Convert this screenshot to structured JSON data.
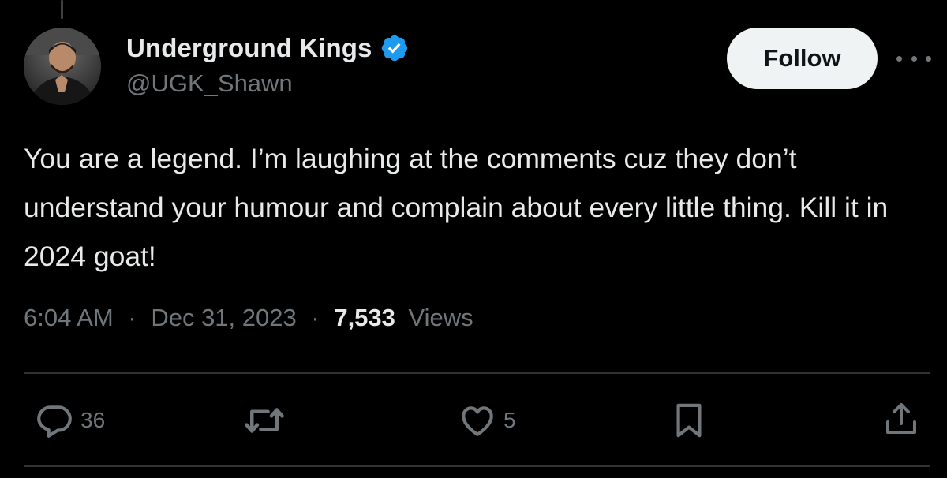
{
  "tweet": {
    "author": {
      "display_name": "Underground Kings",
      "handle": "@UGK_Shawn",
      "verified": true,
      "avatar_icon": "profile-photo"
    },
    "follow_label": "Follow",
    "more_icon": "ellipsis-icon",
    "text": "You are a legend. I’m laughing at the comments cuz they don’t understand your humour and complain about every little thing. Kill it in 2024 goat!",
    "time": "6:04 AM",
    "separator": "·",
    "date": "Dec 31, 2023",
    "views_count": "7,533",
    "views_label": "Views"
  },
  "actions": {
    "reply_count": "36",
    "retweet_count": "",
    "like_count": "5",
    "reply_icon": "reply-icon",
    "retweet_icon": "retweet-icon",
    "like_icon": "heart-icon",
    "bookmark_icon": "bookmark-icon",
    "share_icon": "share-icon"
  },
  "colors": {
    "background": "#000000",
    "primary_text": "#e7e9ea",
    "secondary_text": "#71767b",
    "divider": "#2f3336",
    "verified_blue": "#1d9bf0",
    "follow_bg": "#eff3f4"
  }
}
